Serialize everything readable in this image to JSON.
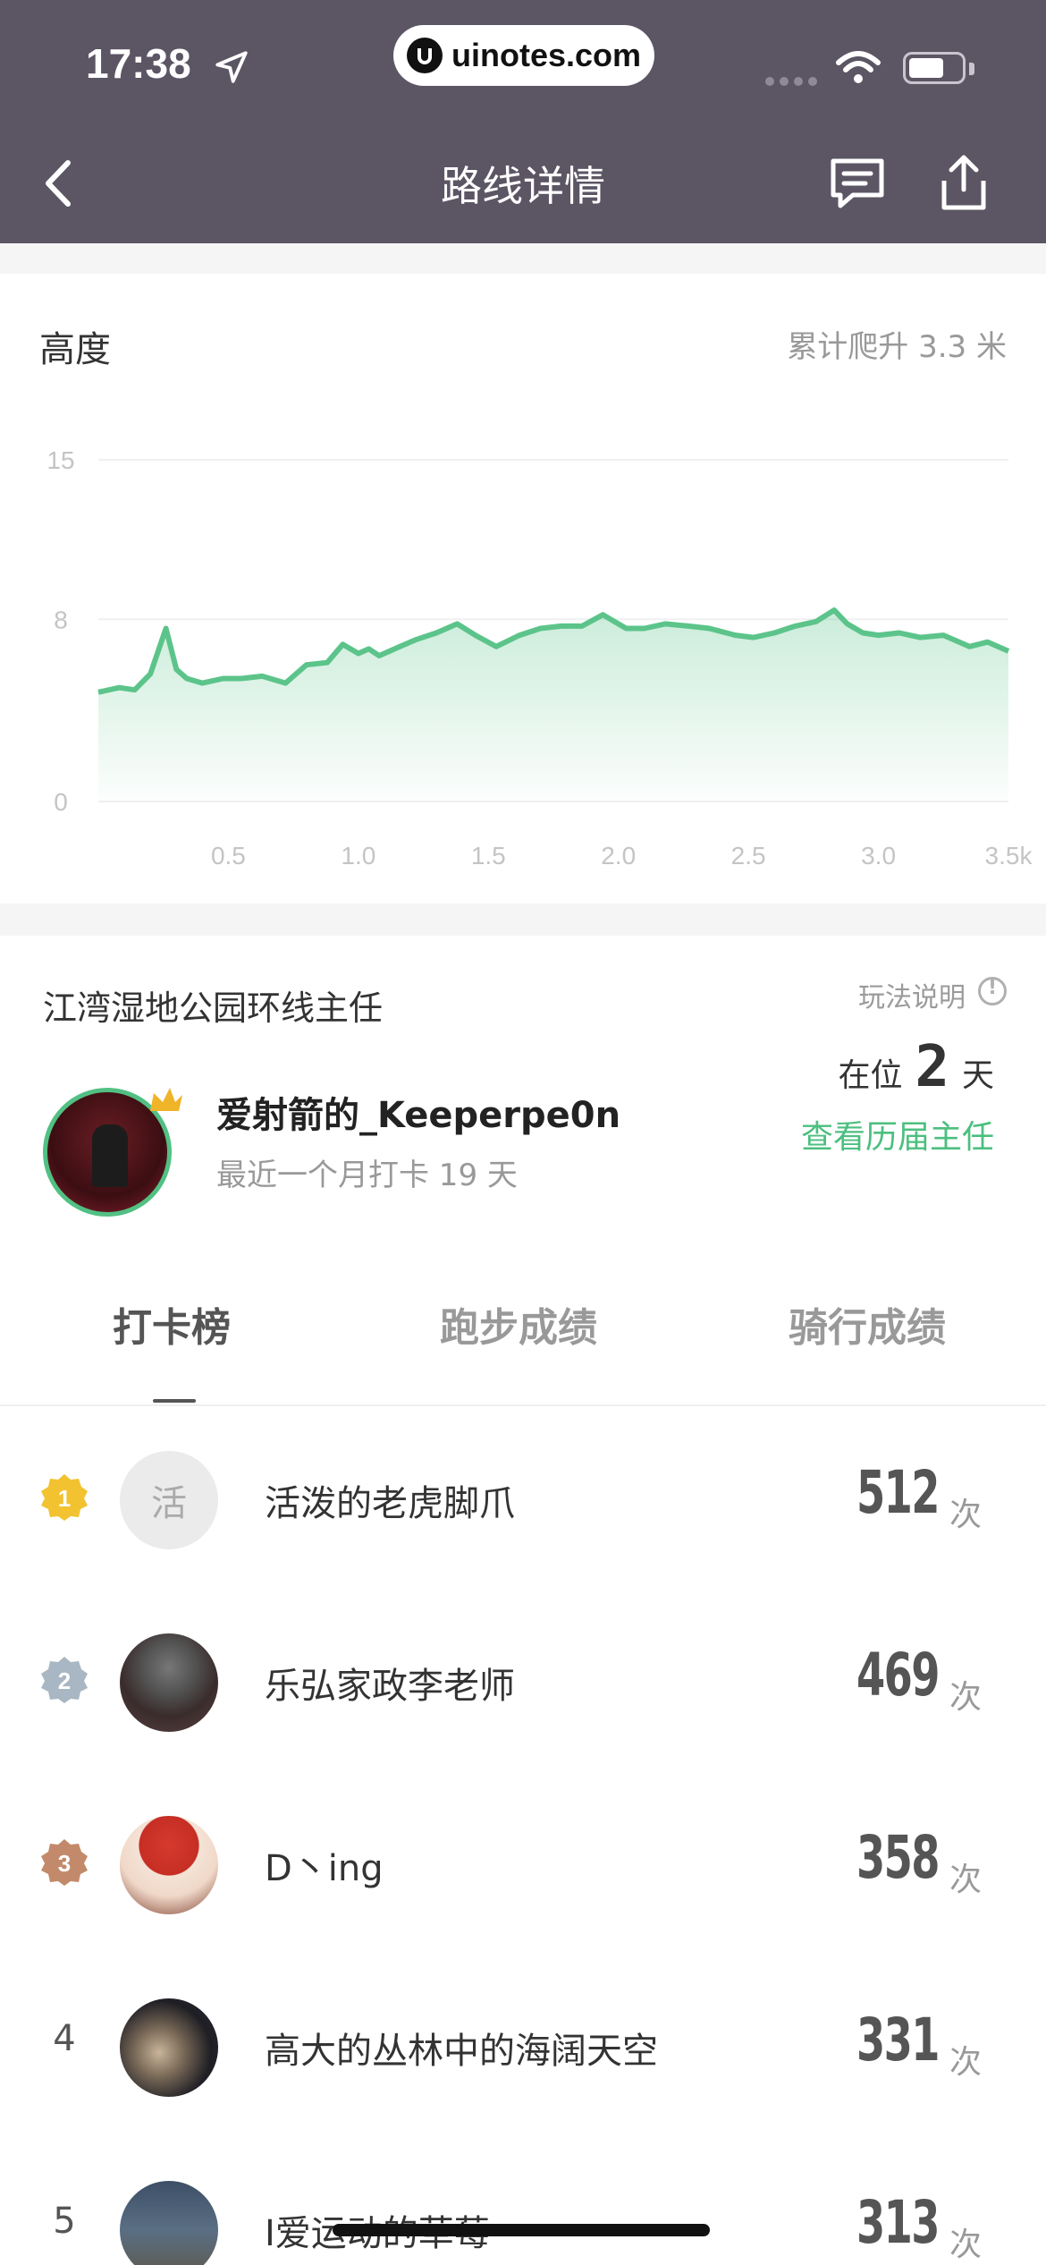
{
  "status_bar": {
    "time": "17:38",
    "url": "uinotes.com"
  },
  "nav": {
    "title": "路线详情"
  },
  "elevation": {
    "title": "高度",
    "summary": "累计爬升 3.3 米",
    "chart_data": {
      "type": "area",
      "title": "",
      "xlabel": "",
      "ylabel": "",
      "x_ticks": [
        "0.5",
        "1.0",
        "1.5",
        "2.0",
        "2.5",
        "3.0",
        "3.5k"
      ],
      "y_ticks": [
        "15",
        "8",
        "0"
      ],
      "xlim": [
        0,
        3.5
      ],
      "ylim": [
        0,
        15
      ],
      "grid": true,
      "line_color": "#5cc48a",
      "x": [
        0,
        0.08,
        0.14,
        0.2,
        0.26,
        0.3,
        0.34,
        0.4,
        0.48,
        0.55,
        0.63,
        0.72,
        0.8,
        0.88,
        0.94,
        1.0,
        1.04,
        1.08,
        1.16,
        1.22,
        1.3,
        1.38,
        1.45,
        1.53,
        1.62,
        1.7,
        1.78,
        1.86,
        1.94,
        2.03,
        2.1,
        2.18,
        2.27,
        2.35,
        2.45,
        2.52,
        2.6,
        2.68,
        2.76,
        2.83,
        2.88,
        2.94,
        3.0,
        3.08,
        3.16,
        3.25,
        3.35,
        3.42,
        3.5
      ],
      "values": [
        4.8,
        5.0,
        4.9,
        5.6,
        7.6,
        5.8,
        5.4,
        5.2,
        5.4,
        5.4,
        5.5,
        5.2,
        6.0,
        6.1,
        6.9,
        6.5,
        6.7,
        6.4,
        6.8,
        7.1,
        7.4,
        7.8,
        7.3,
        6.8,
        7.3,
        7.6,
        7.7,
        7.7,
        8.2,
        7.6,
        7.6,
        7.8,
        7.7,
        7.6,
        7.3,
        7.2,
        7.4,
        7.7,
        7.9,
        8.4,
        7.8,
        7.4,
        7.3,
        7.4,
        7.2,
        7.3,
        6.8,
        7.0,
        6.6
      ]
    }
  },
  "owner": {
    "route_title": "江湾湿地公园环线主任",
    "rules_label": "玩法说明",
    "name": "爱射箭的_Keeperpe0n",
    "subtitle": "最近一个月打卡 19 天",
    "tenure_prefix": "在位",
    "tenure_days": "2",
    "tenure_suffix": "天",
    "history_link": "查看历届主任",
    "accent_color": "#4cbf7f"
  },
  "tabs": [
    {
      "label": "打卡榜",
      "active": true
    },
    {
      "label": "跑步成绩",
      "active": false
    },
    {
      "label": "骑行成绩",
      "active": false
    }
  ],
  "ranking": [
    {
      "rank": "1",
      "medal": "gold-medal-icon",
      "avatar_text": "活",
      "name": "活泼的老虎脚爪",
      "count": "512",
      "unit": "次"
    },
    {
      "rank": "2",
      "medal": "silver-medal-icon",
      "avatar_text": "",
      "name": "乐弘家政李老师",
      "count": "469",
      "unit": "次"
    },
    {
      "rank": "3",
      "medal": "bronze-medal-icon",
      "avatar_text": "",
      "name": "D丶ing",
      "count": "358",
      "unit": "次"
    },
    {
      "rank": "4",
      "medal": "",
      "avatar_text": "",
      "name": "高大的丛林中的海阔天空",
      "count": "331",
      "unit": "次"
    },
    {
      "rank": "5",
      "medal": "",
      "avatar_text": "",
      "name": "I爱运动的草莓",
      "count": "313",
      "unit": "次"
    }
  ]
}
